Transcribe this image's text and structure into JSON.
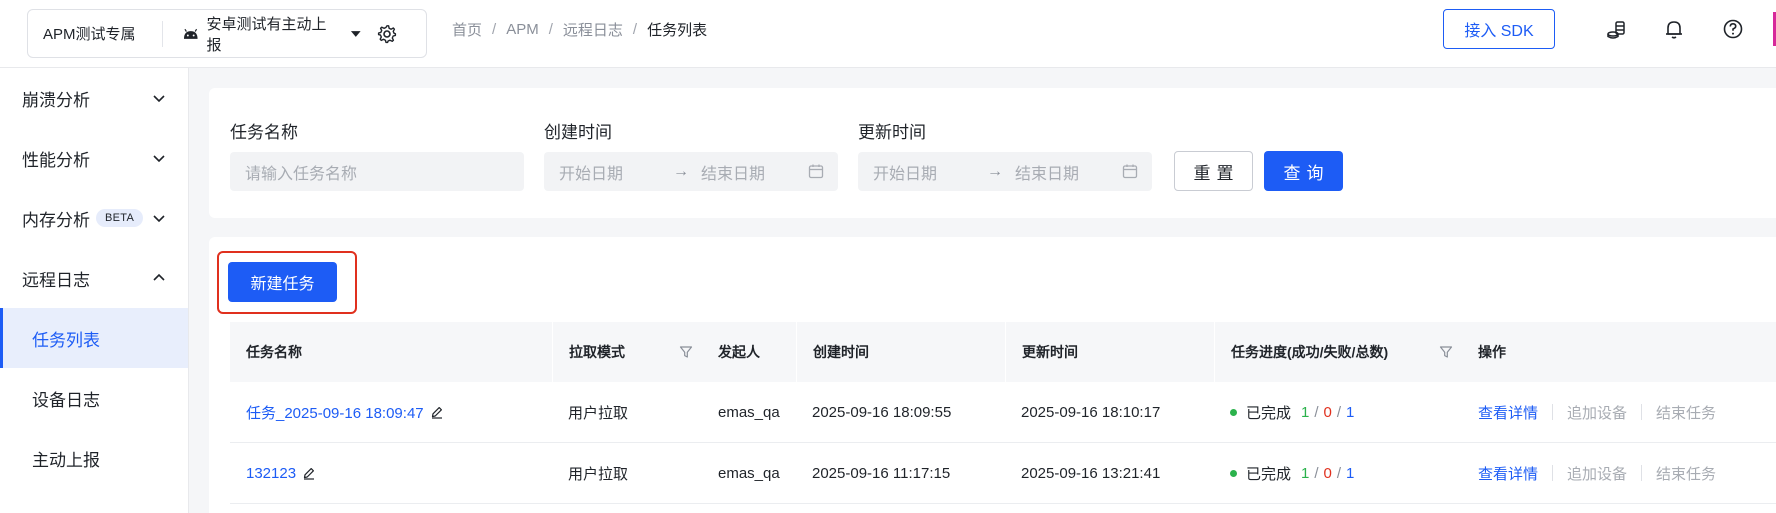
{
  "header": {
    "app_name": "APM测试专属",
    "project_name": "安卓测试有主动上报",
    "breadcrumb": [
      "首页",
      "APM",
      "远程日志",
      "任务列表"
    ],
    "breadcrumb_separator": "/",
    "sdk_button": "接入 SDK",
    "icons": [
      "coins-icon",
      "bell-icon",
      "help-icon"
    ]
  },
  "sidebar": {
    "groups": [
      {
        "label": "崩溃分析",
        "expanded": false
      },
      {
        "label": "性能分析",
        "expanded": false
      },
      {
        "label": "内存分析",
        "badge": "BETA",
        "expanded": false
      },
      {
        "label": "远程日志",
        "expanded": true
      }
    ],
    "sub_items": [
      {
        "label": "任务列表",
        "active": true
      },
      {
        "label": "设备日志",
        "active": false
      },
      {
        "label": "主动上报",
        "active": false
      }
    ]
  },
  "filters": {
    "task_name_label": "任务名称",
    "task_name_placeholder": "请输入任务名称",
    "created_label": "创建时间",
    "updated_label": "更新时间",
    "start_placeholder": "开始日期",
    "end_placeholder": "结束日期",
    "range_arrow": "→",
    "reset_button": "重置",
    "query_button": "查询"
  },
  "table": {
    "new_task_button": "新建任务",
    "columns": [
      "任务名称",
      "拉取模式",
      "发起人",
      "创建时间",
      "更新时间",
      "任务进度(成功/失败/总数)",
      "操作"
    ],
    "rows": [
      {
        "name": "任务_2025-09-16 18:09:47",
        "mode": "用户拉取",
        "initiator": "emas_qa",
        "created": "2025-09-16 18:09:55",
        "updated": "2025-09-16 18:10:17",
        "status": "已完成",
        "success": "1",
        "failed": "0",
        "total": "1"
      },
      {
        "name": "132123",
        "mode": "用户拉取",
        "initiator": "emas_qa",
        "created": "2025-09-16 11:17:15",
        "updated": "2025-09-16 13:21:41",
        "status": "已完成",
        "success": "1",
        "failed": "0",
        "total": "1"
      }
    ],
    "actions": [
      "查看详情",
      "追加设备",
      "结束任务"
    ]
  },
  "colors": {
    "primary": "#1d5cf5",
    "success": "#2bb24c",
    "danger": "#e0301e",
    "highlight_border": "#e0301e"
  }
}
